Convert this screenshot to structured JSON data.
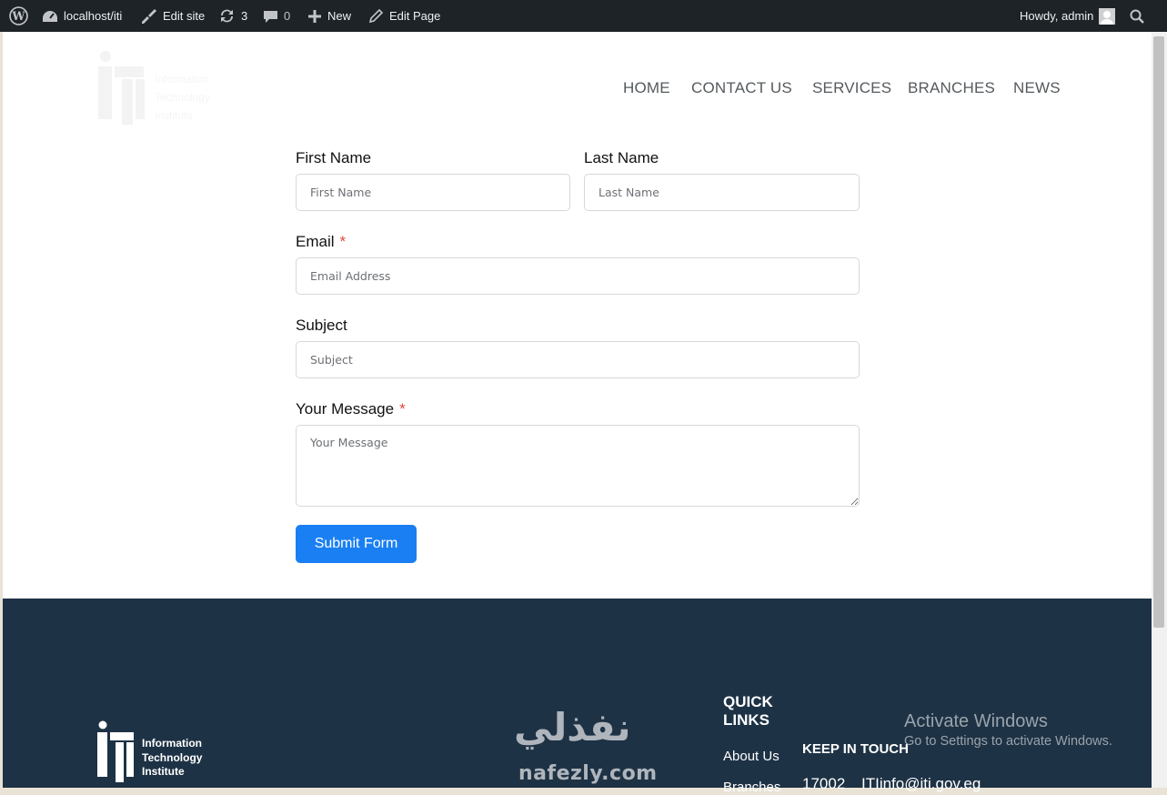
{
  "admin_bar": {
    "site_name": "localhost/iti",
    "edit_site": "Edit site",
    "updates_count": "3",
    "comments_count": "0",
    "new_label": "New",
    "edit_page": "Edit Page",
    "greeting": "Howdy, admin"
  },
  "header": {
    "logo_text": [
      "Information",
      "Technology",
      "Institute"
    ],
    "nav": [
      "HOME",
      "CONTACT US",
      "SERVICES",
      "BRANCHES",
      "NEWS"
    ]
  },
  "form": {
    "first_name": {
      "label": "First Name",
      "placeholder": "First Name",
      "value": ""
    },
    "last_name": {
      "label": "Last Name",
      "placeholder": "Last Name",
      "value": ""
    },
    "email": {
      "label": "Email",
      "required_mark": "*",
      "placeholder": "Email Address",
      "value": ""
    },
    "subject": {
      "label": "Subject",
      "placeholder": "Subject",
      "value": ""
    },
    "message": {
      "label": "Your Message",
      "required_mark": "*",
      "placeholder": "Your Message",
      "value": ""
    },
    "submit_label": "Submit Form"
  },
  "footer": {
    "logo_text": [
      "Information",
      "Technology",
      "Institute"
    ],
    "quick_links_title": "QUICK LINKS",
    "quick_links": [
      "About Us",
      "Branches"
    ],
    "keep_in_touch_title": "KEEP IN TOUCH",
    "phone": "17002",
    "email": "ITIinfo@iti.gov.eg"
  },
  "overlays": {
    "activate_title": "Activate Windows",
    "activate_sub": "Go to Settings to activate Windows.",
    "nafezly_arabic": "نفذلي",
    "nafezly_latin": "nafezly.com"
  },
  "colors": {
    "admin_bar": "#1d2327",
    "footer": "#1e3245",
    "button": "#1a7ff3",
    "required": "#e0483a"
  }
}
